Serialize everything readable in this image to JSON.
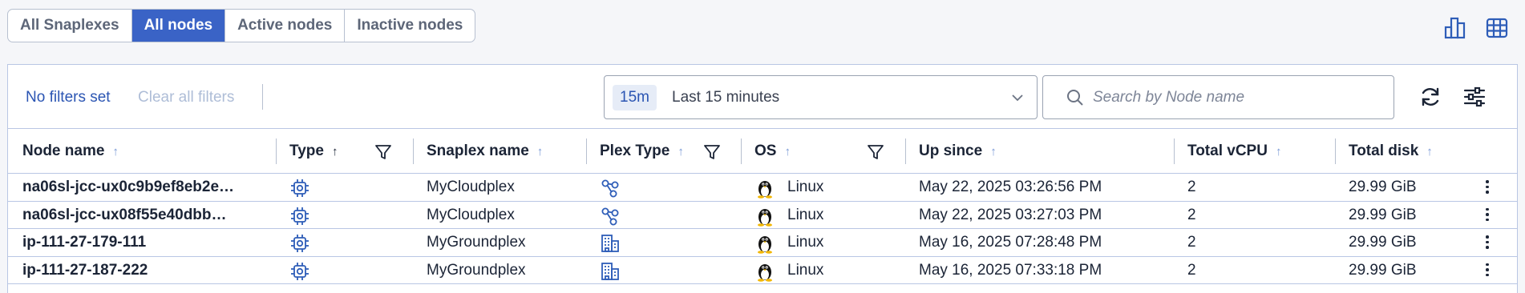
{
  "tabs": [
    {
      "label": "All Snaplexes",
      "active": false
    },
    {
      "label": "All nodes",
      "active": true
    },
    {
      "label": "Active nodes",
      "active": false
    },
    {
      "label": "Inactive nodes",
      "active": false
    }
  ],
  "view_icons": [
    "bar-chart-icon",
    "table-grid-icon"
  ],
  "filters": {
    "status": "No filters set",
    "clear": "Clear all filters"
  },
  "time_range": {
    "chip": "15m",
    "label": "Last 15 minutes"
  },
  "search": {
    "placeholder": "Search by Node name",
    "value": ""
  },
  "columns": {
    "node_name": "Node name",
    "type": "Type",
    "snaplex_name": "Snaplex name",
    "plex_type": "Plex Type",
    "os": "OS",
    "up_since": "Up since",
    "total_vcpu": "Total vCPU",
    "total_disk": "Total disk"
  },
  "sort": {
    "asc": "↑"
  },
  "rows": [
    {
      "node_name": "na06sl-jcc-ux0c9b9ef8eb2e…",
      "type_icon": "cpu-chip-icon",
      "snaplex_name": "MyCloudplex",
      "plex_type_icon": "cloudplex-icon",
      "os": "Linux",
      "up_since": "May 22, 2025 03:26:56 PM",
      "total_vcpu": "2",
      "total_disk": "29.99 GiB"
    },
    {
      "node_name": "na06sl-jcc-ux08f55e40dbb…",
      "type_icon": "cpu-chip-icon",
      "snaplex_name": "MyCloudplex",
      "plex_type_icon": "cloudplex-icon",
      "os": "Linux",
      "up_since": "May 22, 2025 03:27:03 PM",
      "total_vcpu": "2",
      "total_disk": "29.99 GiB"
    },
    {
      "node_name": "ip-111-27-179-111",
      "type_icon": "cpu-chip-icon",
      "snaplex_name": "MyGroundplex",
      "plex_type_icon": "groundplex-icon",
      "os": "Linux",
      "up_since": "May 16, 2025 07:28:48 PM",
      "total_vcpu": "2",
      "total_disk": "29.99 GiB"
    },
    {
      "node_name": "ip-111-27-187-222",
      "type_icon": "cpu-chip-icon",
      "snaplex_name": "MyGroundplex",
      "plex_type_icon": "groundplex-icon",
      "os": "Linux",
      "up_since": "May 16, 2025 07:33:18 PM",
      "total_vcpu": "2",
      "total_disk": "29.99 GiB"
    }
  ],
  "colors": {
    "accent": "#3a63c6",
    "link": "#2b55b3",
    "icon_blue": "#2e5db8"
  }
}
